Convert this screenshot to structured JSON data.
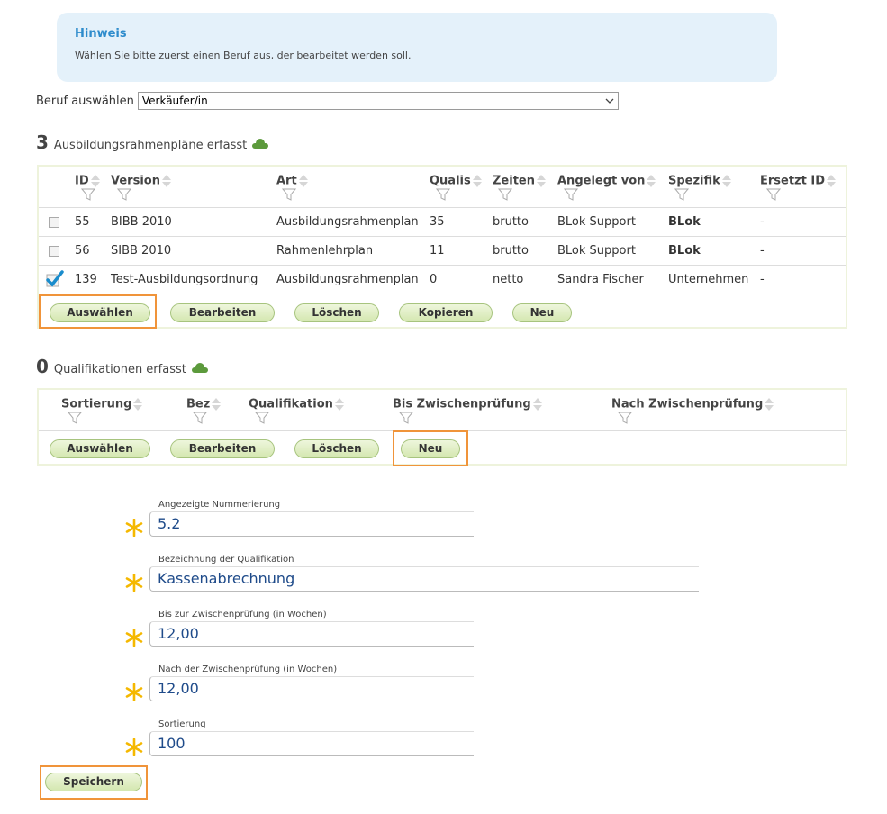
{
  "hint": {
    "title": "Hinweis",
    "text": "Wählen Sie bitte zuerst einen Beruf aus, der bearbeitet werden soll."
  },
  "beruf": {
    "label": "Beruf auswählen",
    "selected": "Verkäufer/in"
  },
  "plans": {
    "count": "3",
    "label": "Ausbildungsrahmenpläne erfasst",
    "columns": [
      "ID",
      "Version",
      "Art",
      "Qualis",
      "Zeiten",
      "Angelegt von",
      "Spezifik",
      "Ersetzt ID"
    ],
    "rows": [
      {
        "checked": false,
        "id": "55",
        "version": "BIBB 2010",
        "art": "Ausbildungsrahmenplan",
        "qualis": "35",
        "zeiten": "brutto",
        "angelegt": "BLok Support",
        "spezifik": "BLok",
        "ersetzt": "-"
      },
      {
        "checked": false,
        "id": "56",
        "version": "SIBB 2010",
        "art": "Rahmenlehrplan",
        "qualis": "11",
        "zeiten": "brutto",
        "angelegt": "BLok Support",
        "spezifik": "BLok",
        "ersetzt": "-"
      },
      {
        "checked": true,
        "id": "139",
        "version": "Test-Ausbildungsordnung",
        "art": "Ausbildungsrahmenplan",
        "qualis": "0",
        "zeiten": "netto",
        "angelegt": "Sandra Fischer",
        "spezifik": "Unternehmen",
        "ersetzt": "-"
      }
    ],
    "buttons": [
      "Auswählen",
      "Bearbeiten",
      "Löschen",
      "Kopieren",
      "Neu"
    ]
  },
  "quals": {
    "count": "0",
    "label": "Qualifikationen erfasst",
    "columns": [
      "Sortierung",
      "Bez",
      "Qualifikation",
      "Bis Zwischenprüfung",
      "Nach Zwischenprüfung"
    ],
    "buttons": [
      "Auswählen",
      "Bearbeiten",
      "Löschen",
      "Neu"
    ]
  },
  "form": {
    "fields": [
      {
        "label": "Angezeigte Nummerierung",
        "value": "5.2"
      },
      {
        "label": "Bezeichnung der Qualifikation",
        "value": "Kassenabrechnung"
      },
      {
        "label": "Bis zur Zwischenprüfung (in Wochen)",
        "value": "12,00"
      },
      {
        "label": "Nach der Zwischenprüfung (in Wochen)",
        "value": "12,00"
      },
      {
        "label": "Sortierung",
        "value": "100"
      }
    ],
    "save_label": "Speichern"
  },
  "colors": {
    "accent": "#2e8ccc",
    "highlight": "#f0943a",
    "star": "#f5b800",
    "button_border": "#a7c47e",
    "checkmark": "#1a8ccc"
  }
}
